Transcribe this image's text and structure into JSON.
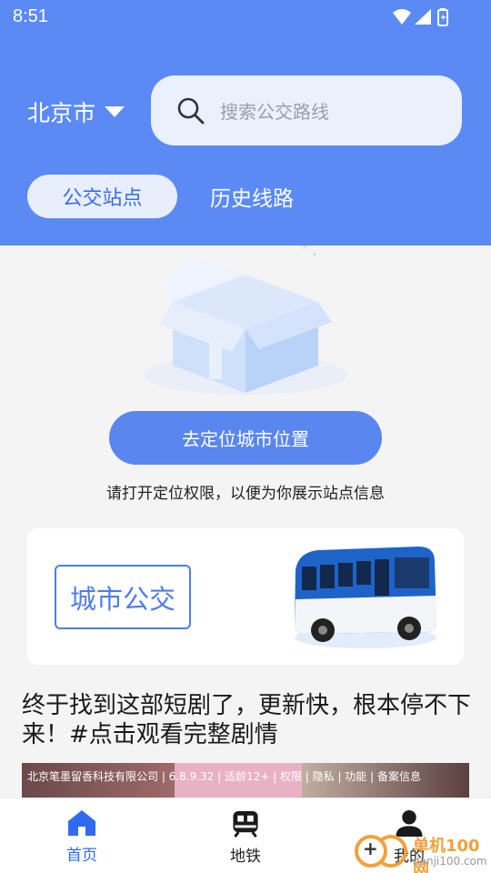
{
  "status_bar": {
    "time": "8:51"
  },
  "header": {
    "city": "北京市",
    "search_placeholder": "搜索公交路线",
    "tabs": [
      {
        "label": "公交站点",
        "active": true
      },
      {
        "label": "历史线路",
        "active": false
      }
    ]
  },
  "empty_state": {
    "button": "去定位城市位置",
    "hint": "请打开定位权限，以便为你展示站点信息"
  },
  "city_bus_card": {
    "label": "城市公交"
  },
  "ad": {
    "title": "终于找到这部短剧了，更新快，根本停不下来！#点击观看完整剧情",
    "meta": "北京笔墨留香科技有限公司 | 6.8.9.32 | 适龄12+ | 权限 | 隐私 | 功能 | 备案信息"
  },
  "bottom_nav": [
    {
      "label": "首页",
      "icon": "home-icon",
      "active": true
    },
    {
      "label": "地铁",
      "icon": "subway-icon",
      "active": false
    },
    {
      "label": "我的",
      "icon": "person-icon",
      "active": false
    }
  ],
  "watermark": {
    "title": "单机100网",
    "url": "danji100.com"
  },
  "colors": {
    "header": "#5b8af5",
    "accent": "#2f6bf0",
    "button": "#5a86f0"
  }
}
